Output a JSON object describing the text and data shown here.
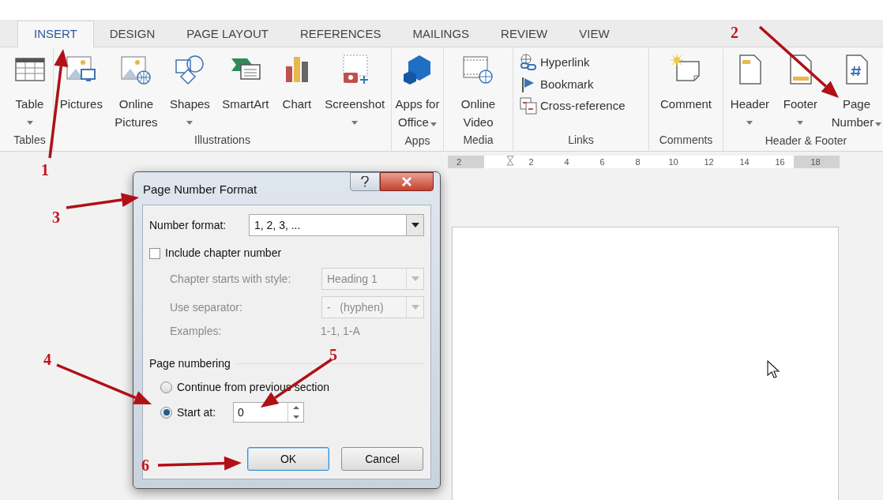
{
  "tabs": [
    {
      "label": "INSERT",
      "selected": true
    },
    {
      "label": "DESIGN",
      "selected": false
    },
    {
      "label": "PAGE LAYOUT",
      "selected": false
    },
    {
      "label": "REFERENCES",
      "selected": false
    },
    {
      "label": "MAILINGS",
      "selected": false
    },
    {
      "label": "REVIEW",
      "selected": false
    },
    {
      "label": "VIEW",
      "selected": false
    }
  ],
  "ribbon": {
    "groups": [
      {
        "label": "Tables",
        "buttons": [
          {
            "kind": "menu",
            "label": "Table"
          }
        ]
      },
      {
        "label": "Illustrations",
        "buttons": [
          {
            "kind": "large",
            "label": "Pictures"
          },
          {
            "kind": "large",
            "label": "Online\nPictures"
          },
          {
            "kind": "menu",
            "label": "Shapes"
          },
          {
            "kind": "large",
            "label": "SmartArt"
          },
          {
            "kind": "large",
            "label": "Chart"
          },
          {
            "kind": "menu",
            "label": "Screenshot"
          }
        ]
      },
      {
        "label": "Apps",
        "buttons": [
          {
            "kind": "menu_inline",
            "label": "Apps for\nOffice"
          }
        ]
      },
      {
        "label": "Media",
        "buttons": [
          {
            "kind": "large",
            "label": "Online\nVideo"
          }
        ]
      },
      {
        "label": "Links",
        "buttons": [
          {
            "kind": "small",
            "label": "Hyperlink"
          },
          {
            "kind": "small",
            "label": "Bookmark"
          },
          {
            "kind": "small",
            "label": "Cross-reference"
          }
        ]
      },
      {
        "label": "Comments",
        "buttons": [
          {
            "kind": "large",
            "label": "Comment"
          }
        ]
      },
      {
        "label": "Header & Footer",
        "buttons": [
          {
            "kind": "menu",
            "label": "Header"
          },
          {
            "kind": "menu",
            "label": "Footer"
          },
          {
            "kind": "menu_inline",
            "label": "Page\nNumber"
          }
        ]
      }
    ]
  },
  "ruler": {
    "labels": [
      "2",
      "2",
      "4",
      "6",
      "8",
      "10",
      "12",
      "14",
      "16",
      "18"
    ]
  },
  "dialog": {
    "title": "Page Number Format",
    "number_format": {
      "label": "Number format:",
      "value": "1, 2, 3, ..."
    },
    "include_chapter": {
      "label": "Include chapter number",
      "checked": false
    },
    "chapter_fields": [
      {
        "label": "Chapter starts with style:",
        "value": "Heading 1",
        "disabled": true
      },
      {
        "label": "Use separator:",
        "value": "-   (hyphen)",
        "disabled": true
      }
    ],
    "examples": {
      "label": "Examples:",
      "value": "1-1, 1-A"
    },
    "page_numbering": {
      "title": "Page numbering",
      "options": [
        {
          "label": "Continue from previous section",
          "selected": false
        },
        {
          "label": "Start at:",
          "selected": true,
          "value": "0"
        }
      ]
    },
    "buttons": [
      {
        "label": "OK",
        "default": true
      },
      {
        "label": "Cancel",
        "default": false
      }
    ]
  },
  "annotations": [
    {
      "label": "1"
    },
    {
      "label": "2"
    },
    {
      "label": "3"
    },
    {
      "label": "4"
    },
    {
      "label": "5"
    },
    {
      "label": "6"
    }
  ]
}
